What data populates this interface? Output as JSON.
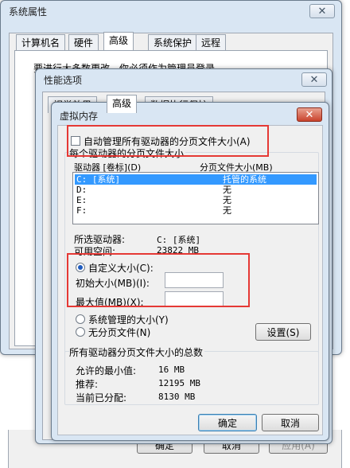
{
  "sysprop": {
    "title": "系统属性",
    "close": "✕",
    "tabs": [
      "计算机名",
      "硬件",
      "高级",
      "系统保护",
      "远程"
    ],
    "partial_text": "要进行大多数更改，你必须作为管理员登录。",
    "buttons": {
      "ok": "确定",
      "cancel": "取消",
      "apply": "应用(A)"
    }
  },
  "perf": {
    "title": "性能选项",
    "close": "✕",
    "tabs": [
      "视觉效果",
      "高级",
      "数据执行保护"
    ]
  },
  "vm": {
    "title": "虚拟内存",
    "close": "✕",
    "auto_manage_label": "自动管理所有驱动器的分页文件大小(A)",
    "auto_manage_checked": false,
    "group_drives_label": "每个驱动器的分页文件大小",
    "col_drive": "驱动器 [卷标](D)",
    "col_size": "分页文件大小(MB)",
    "drives": [
      {
        "drive": "C:    [系统]",
        "size": "托管的系统",
        "selected": true
      },
      {
        "drive": "D:",
        "size": "无",
        "selected": false
      },
      {
        "drive": "E:",
        "size": "无",
        "selected": false
      },
      {
        "drive": "F:",
        "size": "无",
        "selected": false
      }
    ],
    "selected_drive_label": "所选驱动器:",
    "selected_drive_value": "C:  [系统]",
    "free_space_label": "可用空间:",
    "free_space_value": "23822 MB",
    "custom_size_label": "自定义大小(C):",
    "initial_size_label": "初始大小(MB)(I):",
    "initial_size_value": "",
    "max_size_label": "最大值(MB)(X):",
    "max_size_value": "",
    "system_managed_label": "系统管理的大小(Y)",
    "no_paging_label": "无分页文件(N)",
    "set_button": "设置(S)",
    "total_group_label": "所有驱动器分页文件大小的总数",
    "min_allowed_label": "允许的最小值:",
    "min_allowed_value": "16 MB",
    "recommended_label": "推荐:",
    "recommended_value": "12195 MB",
    "current_label": "当前已分配:",
    "current_value": "8130 MB",
    "ok": "确定",
    "cancel": "取消"
  },
  "colors": {
    "highlight": "#e53935",
    "selection": "#3399ff",
    "window_frame": "#d9e6f3"
  }
}
